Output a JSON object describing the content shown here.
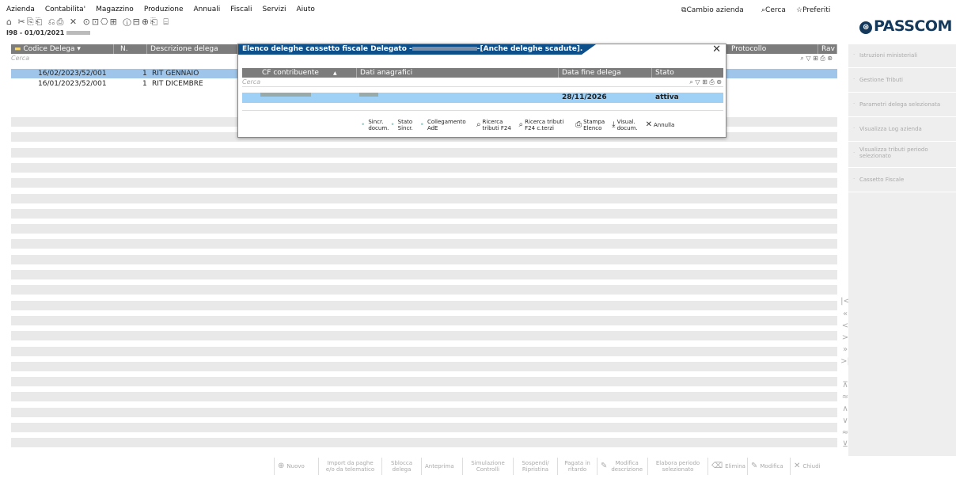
{
  "menu": {
    "items": [
      "Azienda",
      "Contabilita'",
      "Magazzino",
      "Produzione",
      "Annuali",
      "Fiscali",
      "Servizi",
      "Aiuto"
    ],
    "toolbar_icons": "⌂ ✂⎘⎗ ⎌⎙ ✕ ⊙⊡⎔⊞ ⓘ⊟⊕⎗ ⌸"
  },
  "company": {
    "label": "I98 - 01/01/2021"
  },
  "top_right": {
    "cambio": "Cambio azienda",
    "cerca": "Cerca",
    "preferiti": "Preferiti"
  },
  "logo": {
    "mark": "⊛",
    "text": "PASSCOM",
    "color": "#14395b"
  },
  "grid": {
    "columns": [
      "Codice Delega",
      "N.",
      "Descrizione delega",
      "Protocollo",
      "Rav"
    ],
    "search_placeholder": "Cerca",
    "search_icons": "⌕ ▽ ⊞ ⎙ ⊛",
    "rows": [
      {
        "codice": "16/02/2023/52/001",
        "n": "1",
        "desc": "RIT GENNAIO"
      },
      {
        "codice": "16/01/2023/52/001",
        "n": "1",
        "desc": "RIT DICEMBRE"
      }
    ]
  },
  "side_panel": {
    "items": [
      "Istruzioni ministeriali",
      "Gestione Tributi",
      "Parametri delega selezionata",
      "Visualizza Log azienda",
      "Visualizza tributi periodo selezionato",
      "Cassetto Fiscale"
    ]
  },
  "nav": {
    "top": [
      "|<",
      "«",
      "<",
      ">",
      "»",
      ">|"
    ],
    "bottom": [
      "⊼",
      "≈",
      "∧",
      "∨",
      "≈",
      "⊻"
    ]
  },
  "bottom_toolbar": [
    {
      "icon": "⊕",
      "label": "Nuovo"
    },
    {
      "icon": "",
      "label": "Import da paghe e/o da telematico"
    },
    {
      "icon": "",
      "label": "Sblocca delega"
    },
    {
      "icon": "",
      "label": "Anteprima"
    },
    {
      "icon": "",
      "label": "Simulazione Controlli"
    },
    {
      "icon": "",
      "label": "Sospendi/ Ripristina"
    },
    {
      "icon": "",
      "label": "Pagata in ritardo"
    },
    {
      "icon": "✎",
      "label": "Modifica descrizione"
    },
    {
      "icon": "",
      "label": "Elabora periodo selezionato"
    },
    {
      "icon": "⌫",
      "label": "Elimina"
    },
    {
      "icon": "✎",
      "label": "Modifica"
    },
    {
      "icon": "✕",
      "label": "Chiudi"
    }
  ],
  "dialog": {
    "title_prefix": "Elenco deleghe cassetto fiscale Delegato -",
    "title_suffix": "-[Anche deleghe scadute].",
    "close": "✕",
    "columns": [
      "CF contribuente",
      "Dati anagrafici",
      "Data fine delega",
      "Stato"
    ],
    "sort_indicator": "▲",
    "search_placeholder": "Cerca",
    "search_icons": "⌕ ▽ ⊞ ⎙ ⊛",
    "row": {
      "data_fine": "28/11/2026",
      "stato": "attiva"
    },
    "toolbar": [
      {
        "icon": "",
        "label": "Sincr. docum."
      },
      {
        "icon": "",
        "label": "Stato Sincr."
      },
      {
        "icon": "",
        "label": "Collegamento AdE"
      },
      {
        "icon": "⌕",
        "label": "Ricerca tributi F24"
      },
      {
        "icon": "⌕",
        "label": "Ricerca tributi F24 c.terzi"
      },
      {
        "icon": "⎙",
        "label": "Stampa Elenco"
      },
      {
        "icon": "⤓",
        "label": "Visual. docum."
      },
      {
        "icon": "✕",
        "label": "Annulla"
      }
    ]
  }
}
